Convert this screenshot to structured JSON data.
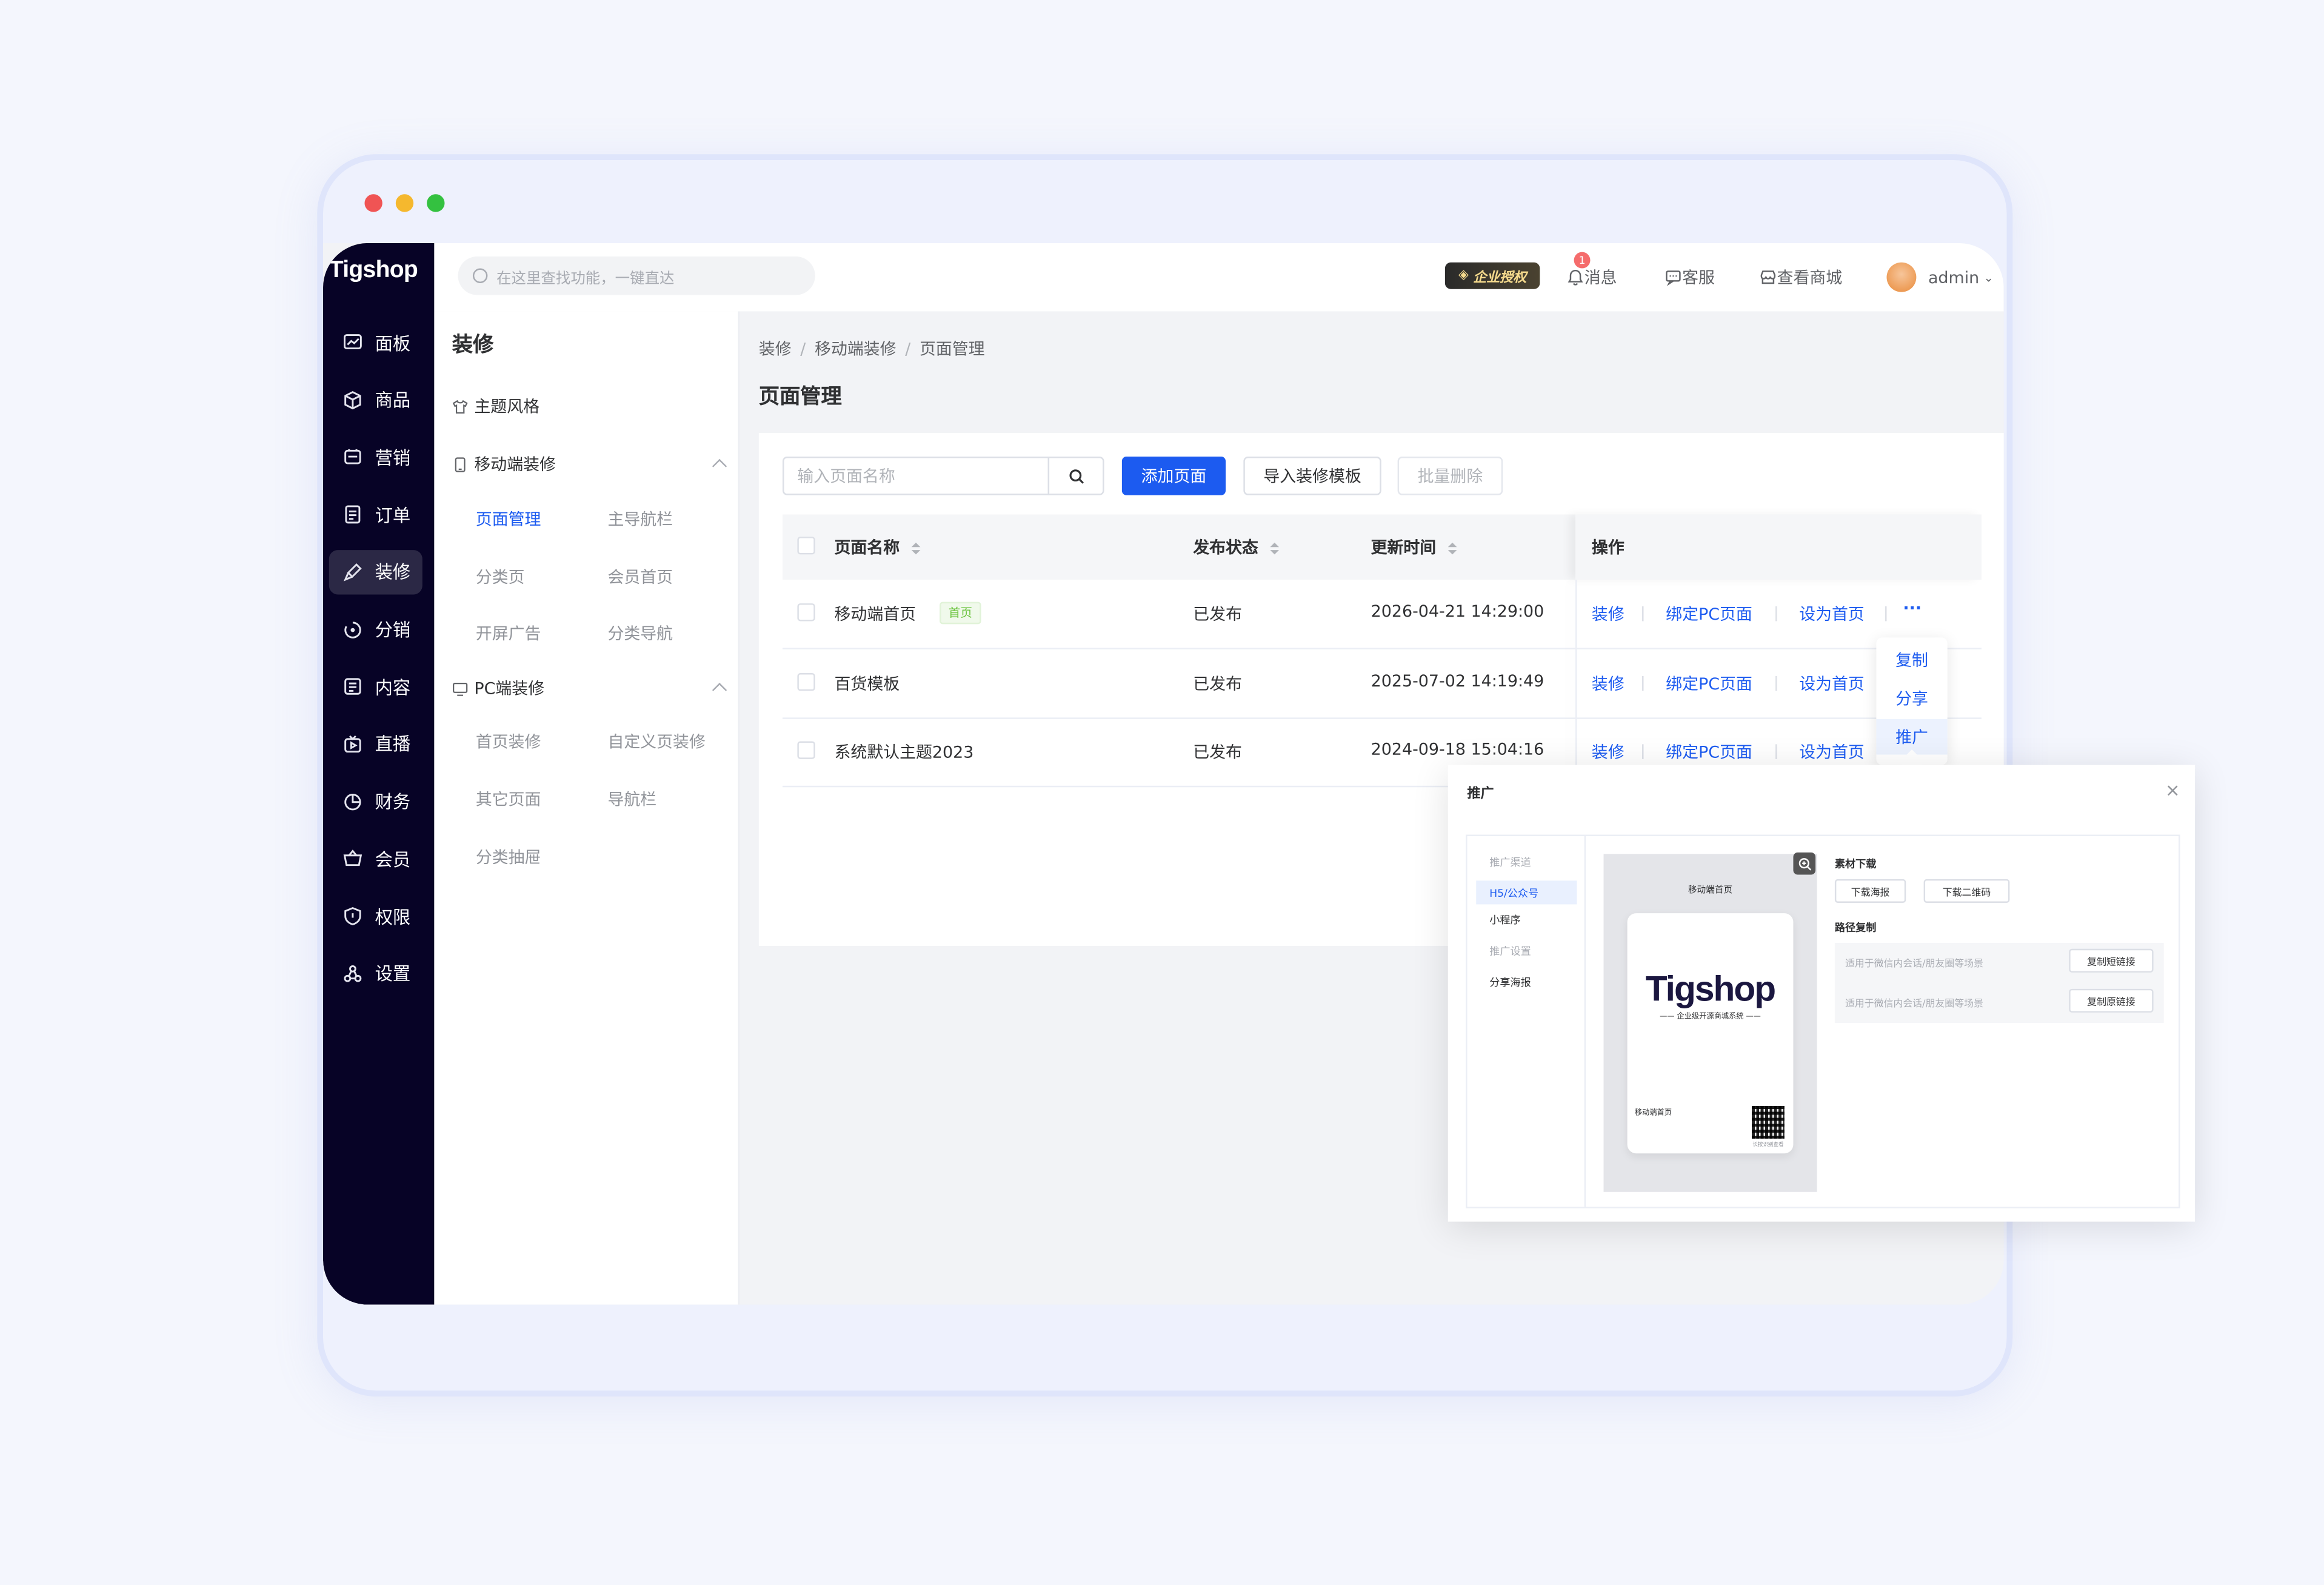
{
  "brand": {
    "name": "Tigshop"
  },
  "colors": {
    "accent": "#1c5bf0",
    "nav_bg": "#070326",
    "red_dot": "#f05454",
    "yellow_dot": "#f5b82e",
    "green_dot": "#34c140",
    "tag_green": "#67c23a"
  },
  "nav": {
    "items": [
      {
        "label": "面板",
        "icon": "dashboard-icon"
      },
      {
        "label": "商品",
        "icon": "box-icon"
      },
      {
        "label": "营销",
        "icon": "marketing-icon"
      },
      {
        "label": "订单",
        "icon": "order-icon"
      },
      {
        "label": "装修",
        "icon": "brush-icon",
        "active": true
      },
      {
        "label": "分销",
        "icon": "distribution-icon"
      },
      {
        "label": "内容",
        "icon": "content-icon"
      },
      {
        "label": "直播",
        "icon": "live-icon"
      },
      {
        "label": "财务",
        "icon": "finance-icon"
      },
      {
        "label": "会员",
        "icon": "basket-icon"
      },
      {
        "label": "权限",
        "icon": "shield-icon"
      },
      {
        "label": "设置",
        "icon": "settings-icon"
      }
    ]
  },
  "header": {
    "search_placeholder": "在这里查找功能，一键直达",
    "auth_badge": "企业授权",
    "message_label": "消息",
    "message_count": "1",
    "service_label": "客服",
    "shop_label": "查看商城",
    "user_name": "admin"
  },
  "submenu": {
    "title": "装修",
    "theme_label": "主题风格",
    "mobile_group": "移动端装修",
    "mobile_links": [
      "页面管理",
      "主导航栏",
      "分类页",
      "会员首页",
      "开屏广告",
      "分类导航"
    ],
    "pc_group": "PC端装修",
    "pc_links": [
      "首页装修",
      "自定义页装修",
      "其它页面",
      "导航栏",
      "分类抽屉"
    ]
  },
  "breadcrumb": [
    "装修",
    "移动端装修",
    "页面管理"
  ],
  "page_title": "页面管理",
  "toolbar": {
    "name_placeholder": "输入页面名称",
    "add_label": "添加页面",
    "import_label": "导入装修模板",
    "batch_delete_label": "批量删除"
  },
  "table": {
    "headers": {
      "name": "页面名称",
      "status": "发布状态",
      "time": "更新时间",
      "ops": "操作"
    },
    "rows": [
      {
        "name": "移动端首页",
        "tag": "首页",
        "status": "已发布",
        "time": "2026-04-21 14:29:00"
      },
      {
        "name": "百货模板",
        "tag": "",
        "status": "已发布",
        "time": "2025-07-02 14:19:49"
      },
      {
        "name": "系统默认主题2023",
        "tag": "",
        "status": "已发布",
        "time": "2024-09-18 15:04:16"
      }
    ],
    "actions": {
      "decorate": "装修",
      "bind_pc": "绑定PC页面",
      "set_home": "设为首页",
      "more": "···"
    }
  },
  "more_menu": [
    "复制",
    "分享",
    "推广"
  ],
  "promo_dialog": {
    "title": "推广",
    "close": "×",
    "side": {
      "channel_heading": "推广渠道",
      "h5": "H5/公众号",
      "miniprogram": "小程序",
      "settings_heading": "推广设置",
      "poster": "分享海报"
    },
    "poster": {
      "page_name": "移动端首页",
      "logo": "Tigshop",
      "slogan": "企业级开源商城系统",
      "footer_name": "移动端首页",
      "qr_caption": "长按识别查看"
    },
    "material_heading": "素材下载",
    "download_poster": "下载海报",
    "download_qr": "下载二维码",
    "path_heading": "路径复制",
    "path_rows": [
      {
        "text": "适用于微信内会话/朋友圈等场景",
        "button": "复制短链接"
      },
      {
        "text": "适用于微信内会话/朋友圈等场景",
        "button": "复制原链接"
      }
    ]
  }
}
